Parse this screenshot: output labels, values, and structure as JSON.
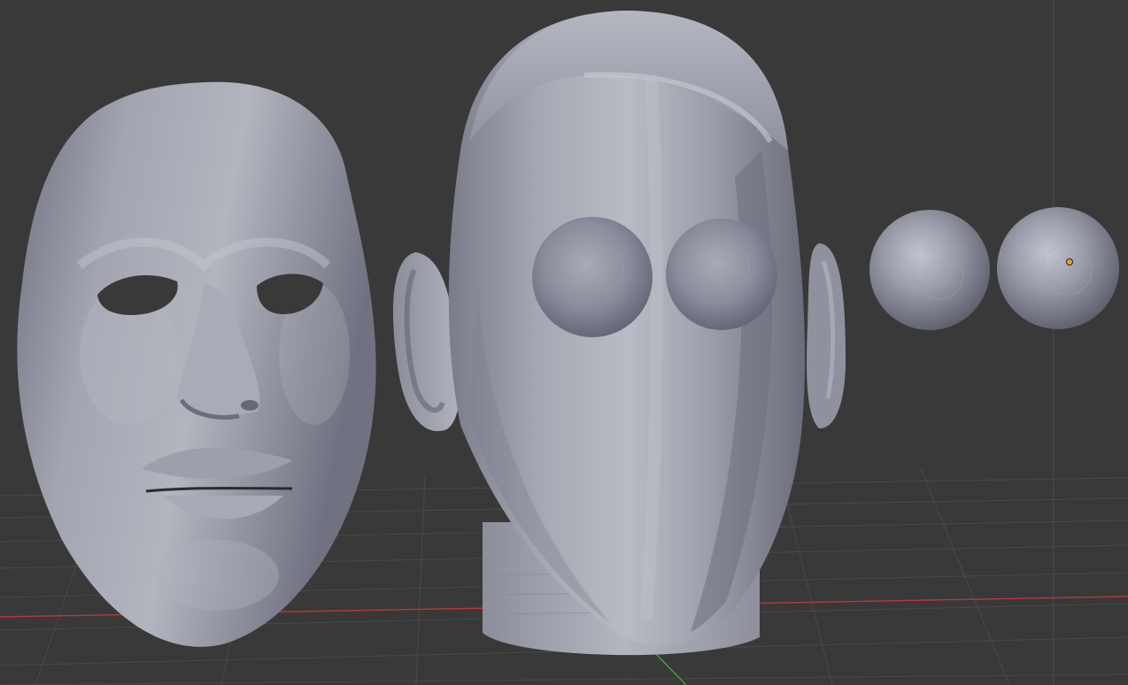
{
  "viewport": {
    "background_color": "#393939",
    "grid_color": "#4a4a4a",
    "x_axis_color": "#b03a3a",
    "y_axis_color": "#3fa33f",
    "grid_visible": true,
    "perspective": true
  },
  "scene": {
    "mesh_color": "#8d8f9c",
    "mesh_highlight": "#c4c6d1",
    "mesh_shadow": "#5f6170",
    "objects": [
      {
        "name": "face-mask",
        "kind": "sculpted-mask",
        "selected": false
      },
      {
        "name": "head",
        "kind": "sculpted-head",
        "selected": false
      },
      {
        "name": "left-ear",
        "kind": "ear",
        "selected": false
      },
      {
        "name": "right-ear",
        "kind": "ear",
        "selected": false
      },
      {
        "name": "eye-sphere-left",
        "kind": "uv-sphere",
        "selected": false
      },
      {
        "name": "eye-sphere-right",
        "kind": "uv-sphere",
        "selected": false
      },
      {
        "name": "sphere-1",
        "kind": "uv-sphere",
        "selected": false
      },
      {
        "name": "sphere-2",
        "kind": "uv-sphere",
        "selected": true
      }
    ],
    "active_origin_color": "#f0a020"
  }
}
